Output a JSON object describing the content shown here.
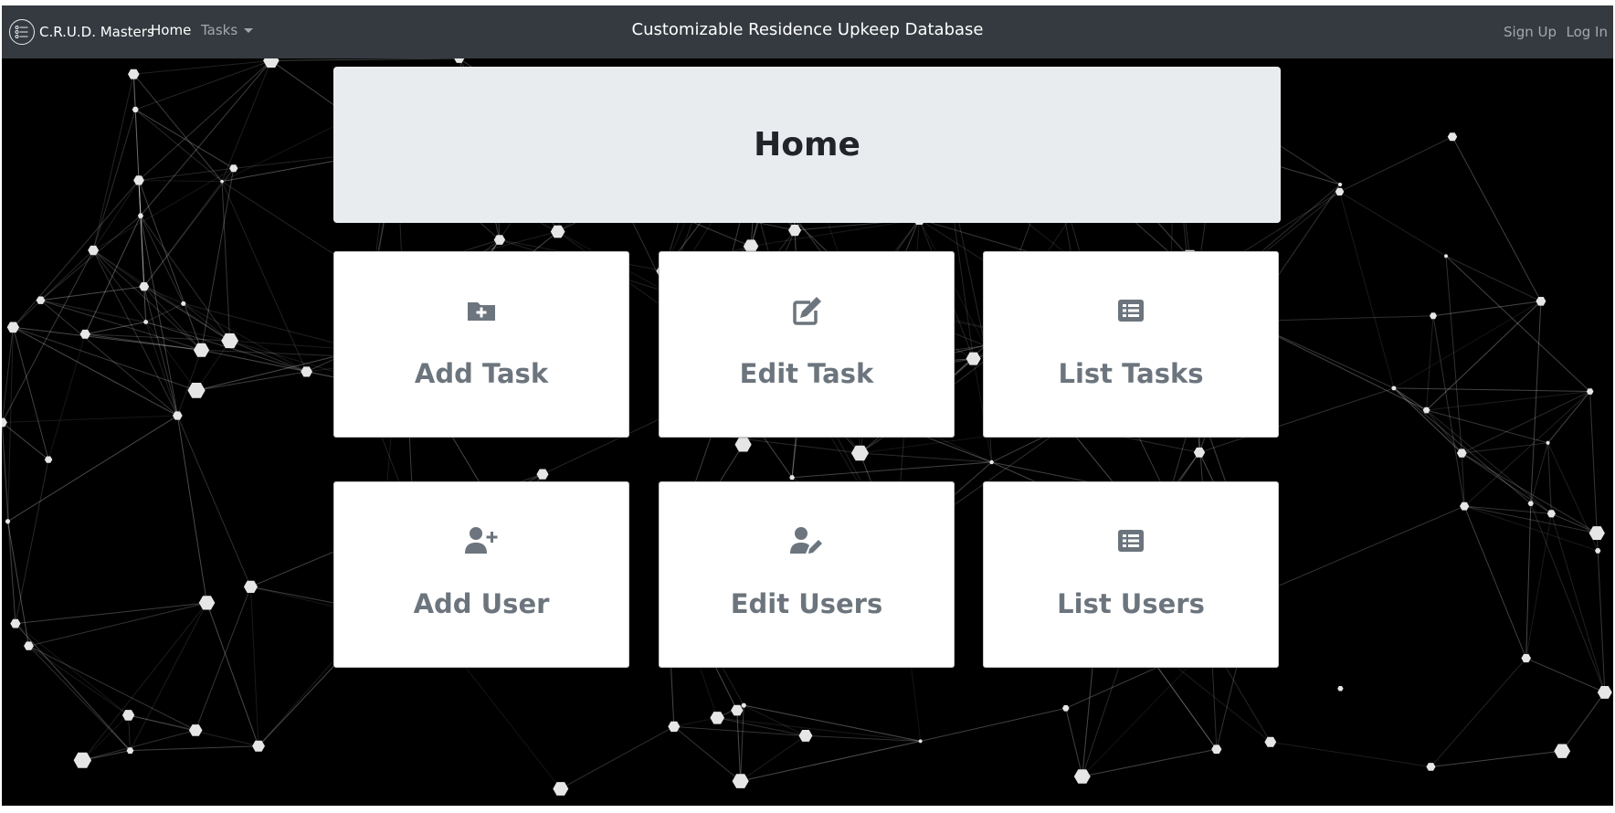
{
  "navbar": {
    "brand": "C.R.U.D. Masters",
    "home": "Home",
    "tasks": "Tasks",
    "title": "Customizable Residence Upkeep Database",
    "sign_up": "Sign Up",
    "log_in": "Log In"
  },
  "page": {
    "heading": "Home"
  },
  "cards": [
    {
      "label": "Add Task",
      "icon": "folder-plus-icon"
    },
    {
      "label": "Edit Task",
      "icon": "edit-icon"
    },
    {
      "label": "List Tasks",
      "icon": "list-icon"
    },
    {
      "label": "Add User",
      "icon": "user-plus-icon"
    },
    {
      "label": "Edit Users",
      "icon": "user-edit-icon"
    },
    {
      "label": "List Users",
      "icon": "list-icon"
    }
  ],
  "colors": {
    "navbar": "#343a40",
    "jumbotron": "#e9ecef",
    "card_text": "#6c757d",
    "background": "#000000"
  }
}
